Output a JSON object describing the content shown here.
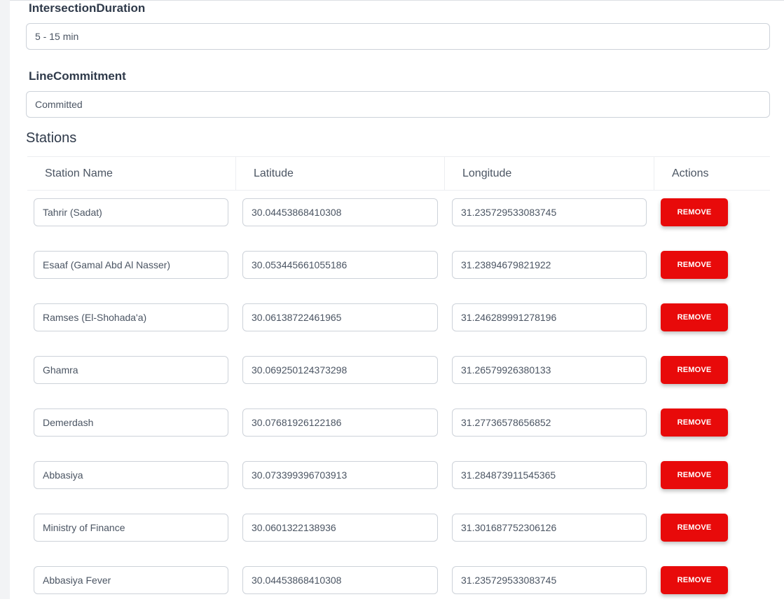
{
  "form": {
    "intersection_duration": {
      "label": "IntersectionDuration",
      "value": "5 - 15 min"
    },
    "line_commitment": {
      "label": "LineCommitment",
      "value": "Committed"
    }
  },
  "stations": {
    "title": "Stations",
    "columns": [
      "Station Name",
      "Latitude",
      "Longitude",
      "Actions"
    ],
    "remove_label": "REMOVE",
    "rows": [
      {
        "name": "Tahrir (Sadat)",
        "lat": "30.04453868410308",
        "lng": "31.235729533083745"
      },
      {
        "name": "Esaaf (Gamal Abd Al Nasser)",
        "lat": "30.053445661055186",
        "lng": "31.23894679821922"
      },
      {
        "name": "Ramses (El-Shohada'a)",
        "lat": "30.06138722461965",
        "lng": "31.246289991278196"
      },
      {
        "name": "Ghamra",
        "lat": "30.069250124373298",
        "lng": "31.26579926380133"
      },
      {
        "name": "Demerdash",
        "lat": "30.07681926122186",
        "lng": "31.27736578656852"
      },
      {
        "name": "Abbasiya",
        "lat": "30.073399396703913",
        "lng": "31.284873911545365"
      },
      {
        "name": "Ministry of Finance",
        "lat": "30.0601322138936",
        "lng": "31.301687752306126"
      },
      {
        "name": "Abbasiya Fever",
        "lat": "30.04453868410308",
        "lng": "31.235729533083745"
      }
    ]
  },
  "colors": {
    "remove_button": "#e80a0a"
  }
}
